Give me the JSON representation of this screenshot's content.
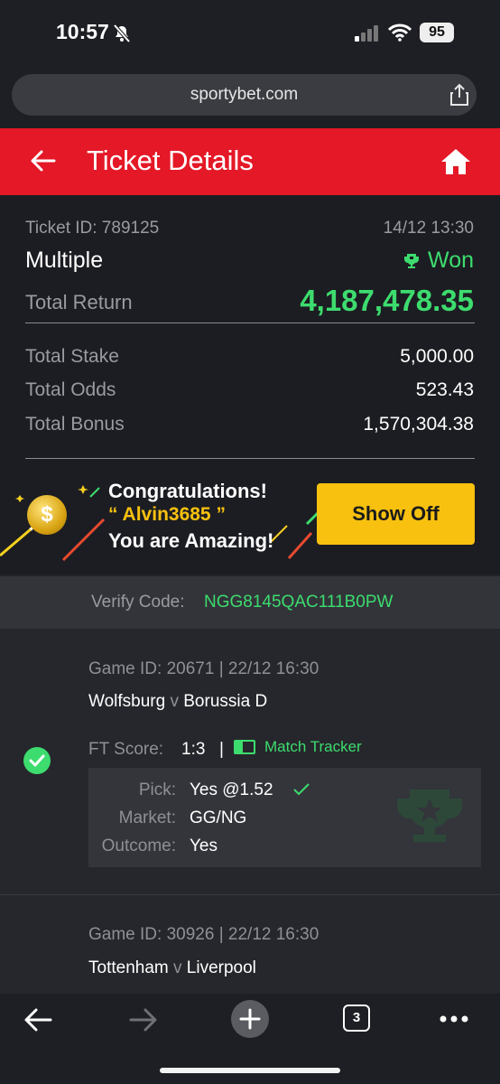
{
  "status_bar": {
    "time": "10:57",
    "battery": "95"
  },
  "browser": {
    "url": "sportybet.com"
  },
  "header": {
    "title": "Ticket Details"
  },
  "ticket": {
    "id_label": "Ticket ID: 789125",
    "date": "14/12 13:30",
    "type": "Multiple",
    "status": "Won",
    "total_return_label": "Total Return",
    "total_return": "4,187,478.35",
    "rows": [
      {
        "label": "Total Stake",
        "value": "5,000.00"
      },
      {
        "label": "Total Odds",
        "value": "523.43"
      },
      {
        "label": "Total Bonus",
        "value": "1,570,304.38"
      }
    ]
  },
  "congrats": {
    "line1": "Congratulations!",
    "line2": "“ Alvin3685 ”",
    "line3": "You are Amazing!",
    "button": "Show Off"
  },
  "verify": {
    "label": "Verify Code:",
    "code": "NGG8145QAC111B0PW"
  },
  "games": [
    {
      "game_id": "Game ID: 20671 | 22/12 16:30",
      "home": "Wolfsburg",
      "vs": "v",
      "away": "Borussia D",
      "ft_label": "FT Score:",
      "ft_score": "1:3",
      "tracker": "Match Tracker",
      "pick_label": "Pick:",
      "pick": "Yes @1.52",
      "market_label": "Market:",
      "market": "GG/NG",
      "outcome_label": "Outcome:",
      "outcome": "Yes"
    },
    {
      "game_id": "Game ID: 30926 | 22/12 16:30",
      "home": "Tottenham",
      "vs": "v",
      "away": "Liverpool"
    }
  ],
  "toolbar": {
    "tabs_count": "3"
  },
  "colors": {
    "brand_red": "#e41827",
    "win_green": "#3ddc6e",
    "button_yellow": "#f8c10f"
  }
}
